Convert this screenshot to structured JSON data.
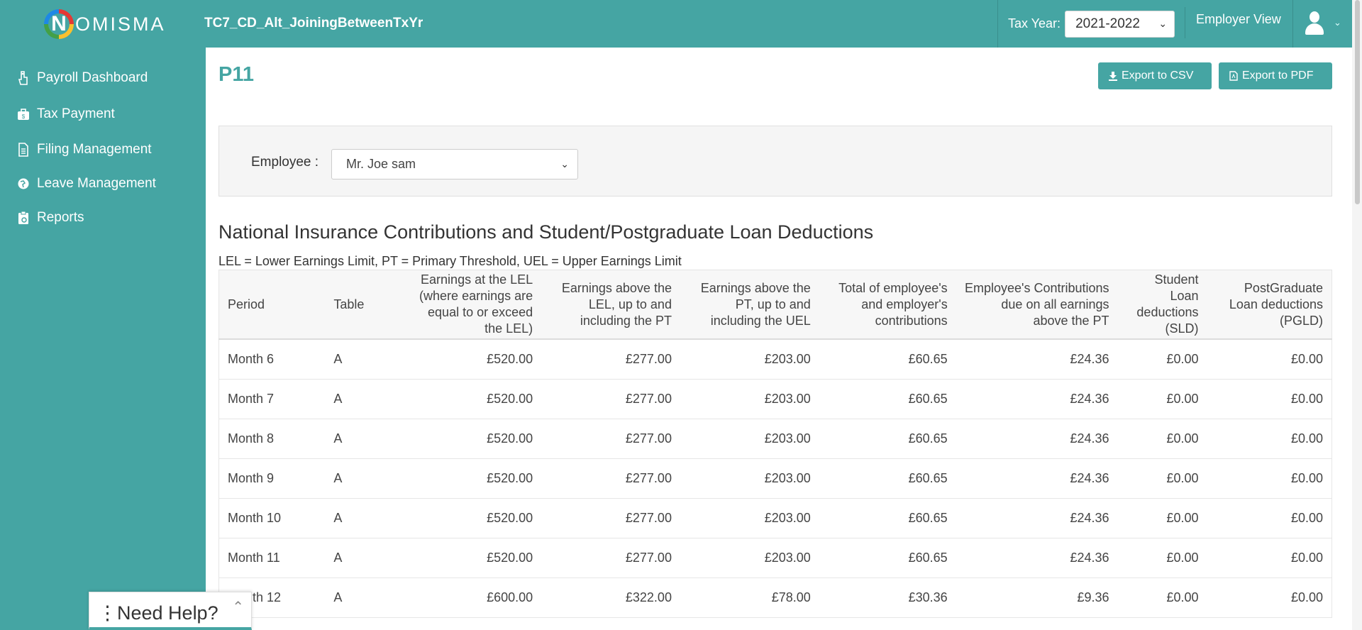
{
  "header": {
    "logo_letter": "N",
    "logo_text": "OMISMA",
    "company_name": "TC7_CD_Alt_JoiningBetweenTxYr",
    "tax_year_label": "Tax Year:",
    "tax_year_value": "2021-2022",
    "employer_view_label": "Employer View"
  },
  "sidebar": {
    "items": [
      {
        "label": "Payroll Dashboard",
        "icon": "hand-coin-icon"
      },
      {
        "label": "Tax Payment",
        "icon": "briefcase-money-icon"
      },
      {
        "label": "Filing Management",
        "icon": "document-icon"
      },
      {
        "label": "Leave Management",
        "icon": "globe-icon"
      },
      {
        "label": "Reports",
        "icon": "clipboard-icon"
      }
    ]
  },
  "main": {
    "title": "P11",
    "export_csv": "Export to CSV",
    "export_pdf": "Export to PDF",
    "employee_label": "Employee :",
    "employee_value": "Mr. Joe sam",
    "section_title": "National Insurance Contributions and Student/Postgraduate Loan Deductions",
    "legend": "LEL = Lower Earnings Limit, PT = Primary Threshold, UEL = Upper Earnings Limit"
  },
  "table": {
    "headers": [
      "Period",
      "Table",
      "Earnings at the LEL (where earnings are equal to or exceed the LEL)",
      "Earnings above the LEL, up to and including the PT",
      "Earnings above the PT, up to and including the UEL",
      "Total of employee's and employer's contributions",
      "Employee's Contributions due on all earnings above the PT",
      "Student Loan deductions (SLD)",
      "PostGraduate Loan deductions (PGLD)"
    ],
    "rows": [
      [
        "Month 6",
        "A",
        "£520.00",
        "£277.00",
        "£203.00",
        "£60.65",
        "£24.36",
        "£0.00",
        "£0.00"
      ],
      [
        "Month 7",
        "A",
        "£520.00",
        "£277.00",
        "£203.00",
        "£60.65",
        "£24.36",
        "£0.00",
        "£0.00"
      ],
      [
        "Month 8",
        "A",
        "£520.00",
        "£277.00",
        "£203.00",
        "£60.65",
        "£24.36",
        "£0.00",
        "£0.00"
      ],
      [
        "Month 9",
        "A",
        "£520.00",
        "£277.00",
        "£203.00",
        "£60.65",
        "£24.36",
        "£0.00",
        "£0.00"
      ],
      [
        "Month 10",
        "A",
        "£520.00",
        "£277.00",
        "£203.00",
        "£60.65",
        "£24.36",
        "£0.00",
        "£0.00"
      ],
      [
        "Month 11",
        "A",
        "£520.00",
        "£277.00",
        "£203.00",
        "£60.65",
        "£24.36",
        "£0.00",
        "£0.00"
      ],
      [
        "Month 12",
        "A",
        "£600.00",
        "£322.00",
        "£78.00",
        "£30.36",
        "£9.36",
        "£0.00",
        "£0.00"
      ]
    ]
  },
  "help_widget": {
    "label": "Need Help?"
  },
  "colors": {
    "brand": "#45a5a3",
    "title": "#45a5a3"
  }
}
